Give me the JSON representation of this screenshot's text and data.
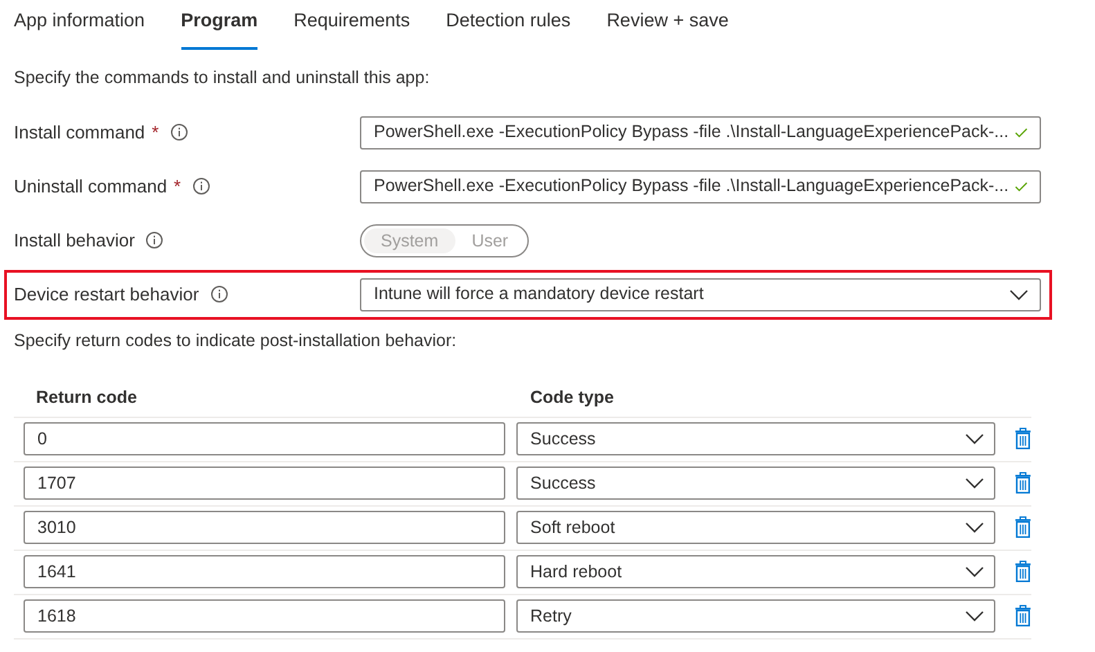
{
  "tabs": [
    {
      "label": "App information",
      "selected": false
    },
    {
      "label": "Program",
      "selected": true
    },
    {
      "label": "Requirements",
      "selected": false
    },
    {
      "label": "Detection rules",
      "selected": false
    },
    {
      "label": "Review + save",
      "selected": false
    }
  ],
  "intro": "Specify the commands to install and uninstall this app:",
  "fields": [
    {
      "kind": "text",
      "label": "Install command",
      "required_mark": "*",
      "value": "PowerShell.exe -ExecutionPolicy Bypass -file .\\Install-LanguageExperiencePack-...",
      "valid": true,
      "highlighted": false
    },
    {
      "kind": "text",
      "label": "Uninstall command",
      "required_mark": "*",
      "value": "PowerShell.exe -ExecutionPolicy Bypass -file .\\Install-LanguageExperiencePack-...",
      "valid": true,
      "highlighted": false
    },
    {
      "kind": "toggle",
      "label": "Install behavior",
      "disabled": true,
      "options": [
        {
          "label": "System",
          "selected": true
        },
        {
          "label": "User",
          "selected": false
        }
      ],
      "highlighted": false
    },
    {
      "kind": "dropdown",
      "label": "Device restart behavior",
      "value": "Intune will force a mandatory device restart",
      "highlighted": true
    }
  ],
  "return_codes_intro": "Specify return codes to indicate post-installation behavior:",
  "table": {
    "columns": [
      "Return code",
      "Code type"
    ],
    "rows": [
      {
        "code": "0",
        "type": "Success"
      },
      {
        "code": "1707",
        "type": "Success"
      },
      {
        "code": "3010",
        "type": "Soft reboot"
      },
      {
        "code": "1641",
        "type": "Hard reboot"
      },
      {
        "code": "1618",
        "type": "Retry"
      }
    ]
  }
}
